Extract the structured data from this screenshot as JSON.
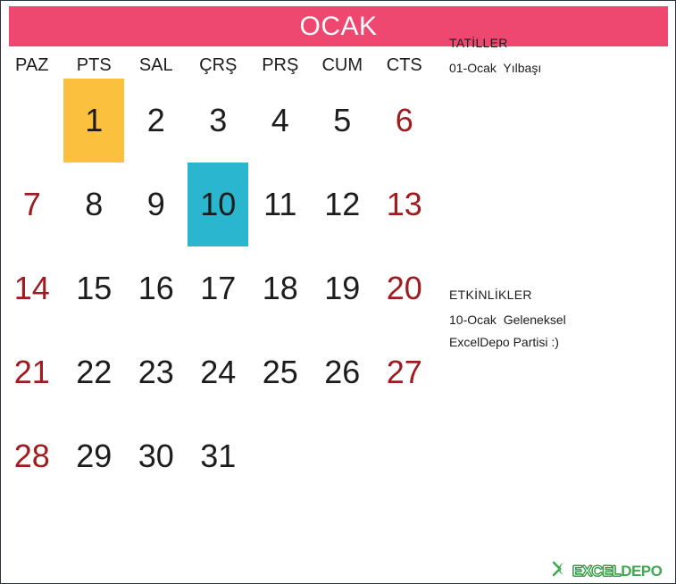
{
  "header": {
    "month_label": "OCAK",
    "bar_color": "#ee4870",
    "title_color": "#ffffff"
  },
  "calendar": {
    "day_names": [
      "PAZ",
      "PTS",
      "SAL",
      "ÇRŞ",
      "PRŞ",
      "CUM",
      "CTS"
    ],
    "weekend_color": "#9e1b1f",
    "weekday_color": "#1c1c1c",
    "holiday_highlight_color": "#fbc03d",
    "event_highlight_color": "#29b6ce",
    "weeks": [
      [
        {
          "day": "",
          "type": "empty"
        },
        {
          "day": "1",
          "type": "holiday"
        },
        {
          "day": "2",
          "type": "weekday"
        },
        {
          "day": "3",
          "type": "weekday"
        },
        {
          "day": "4",
          "type": "weekday"
        },
        {
          "day": "5",
          "type": "weekday"
        },
        {
          "day": "6",
          "type": "weekend"
        }
      ],
      [
        {
          "day": "7",
          "type": "weekend"
        },
        {
          "day": "8",
          "type": "weekday"
        },
        {
          "day": "9",
          "type": "weekday"
        },
        {
          "day": "10",
          "type": "event"
        },
        {
          "day": "11",
          "type": "weekday"
        },
        {
          "day": "12",
          "type": "weekday"
        },
        {
          "day": "13",
          "type": "weekend"
        }
      ],
      [
        {
          "day": "14",
          "type": "weekend"
        },
        {
          "day": "15",
          "type": "weekday"
        },
        {
          "day": "16",
          "type": "weekday"
        },
        {
          "day": "17",
          "type": "weekday"
        },
        {
          "day": "18",
          "type": "weekday"
        },
        {
          "day": "19",
          "type": "weekday"
        },
        {
          "day": "20",
          "type": "weekend"
        }
      ],
      [
        {
          "day": "21",
          "type": "weekend"
        },
        {
          "day": "22",
          "type": "weekday"
        },
        {
          "day": "23",
          "type": "weekday"
        },
        {
          "day": "24",
          "type": "weekday"
        },
        {
          "day": "25",
          "type": "weekday"
        },
        {
          "day": "26",
          "type": "weekday"
        },
        {
          "day": "27",
          "type": "weekend"
        }
      ],
      [
        {
          "day": "28",
          "type": "weekend"
        },
        {
          "day": "29",
          "type": "weekday"
        },
        {
          "day": "30",
          "type": "weekday"
        },
        {
          "day": "31",
          "type": "weekday"
        },
        {
          "day": "",
          "type": "empty"
        },
        {
          "day": "",
          "type": "empty"
        },
        {
          "day": "",
          "type": "empty"
        }
      ]
    ]
  },
  "notes": {
    "holidays": {
      "title": "TATİLLER",
      "lines": [
        "01-Ocak  Yılbaşı"
      ]
    },
    "events": {
      "title": "ETKİNLİKLER",
      "lines": [
        "10-Ocak  Geleneksel",
        "ExcelDepo Partisi :)"
      ]
    }
  },
  "logo": {
    "mark": "chevron-mark",
    "text_primary": "EXCEL",
    "text_secondary": "DEPO",
    "color": "#3faa4f"
  }
}
